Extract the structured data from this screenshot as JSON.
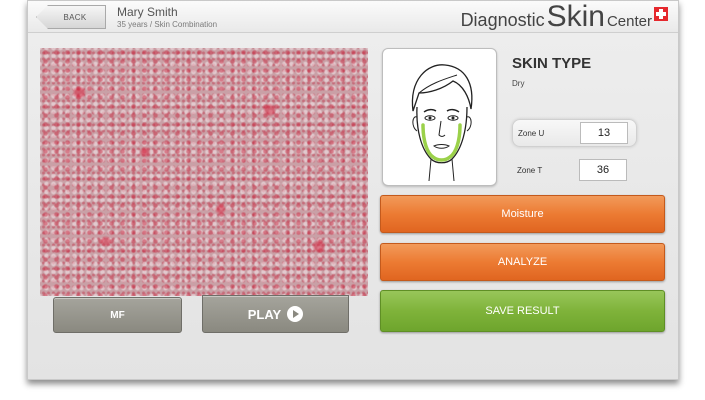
{
  "header": {
    "back_label": "BACK",
    "user_name": "Mary Smith",
    "user_info": "35 years / Skin Combination",
    "brand_word1": "Diagnostic",
    "brand_word2": "Skin",
    "brand_word3": "Center"
  },
  "camera": {
    "mf_label": "MF",
    "play_label": "PLAY"
  },
  "skin_type": {
    "title": "SKIN TYPE",
    "value": "Dry"
  },
  "zones": {
    "u_label": "Zone U",
    "u_value": "13",
    "t_label": "Zone T",
    "t_value": "36"
  },
  "actions": {
    "moisture_label": "Moisture",
    "analyze_label": "ANALYZE",
    "save_label": "SAVE RESULT"
  },
  "colors": {
    "orange_button": "#ec7b33",
    "green_button": "#7fb33a",
    "gray_button": "#9a998f",
    "zone_highlight": "#9bd14a",
    "flag_red": "#e5282d"
  },
  "icons": [
    "back-arrow-icon",
    "play-icon",
    "swiss-flag-icon",
    "face-zone-diagram"
  ]
}
